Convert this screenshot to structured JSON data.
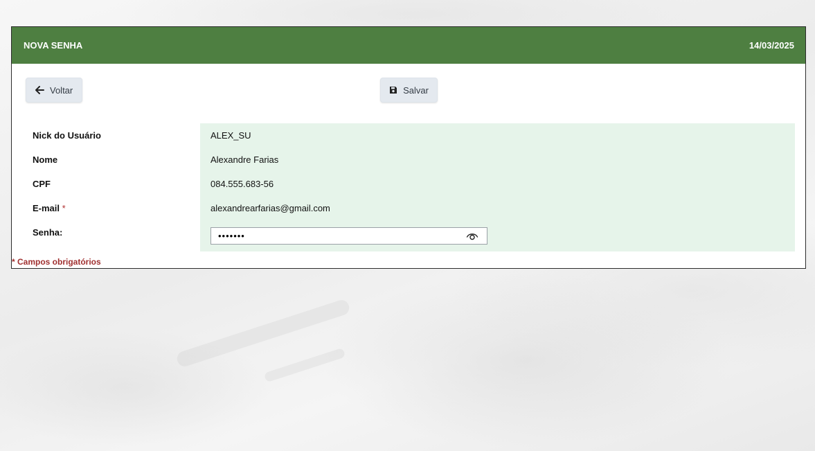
{
  "header": {
    "title": "NOVA SENHA",
    "date": "14/03/2025"
  },
  "toolbar": {
    "back_label": "Voltar",
    "save_label": "Salvar"
  },
  "form": {
    "fields": [
      {
        "label": "Nick do Usuário",
        "value": "ALEX_SU"
      },
      {
        "label": "Nome",
        "value": "Alexandre Farias"
      },
      {
        "label": "CPF",
        "value": "084.555.683-56"
      },
      {
        "label": "E-mail",
        "required_mark": "*",
        "value": "alexandrearfarias@gmail.com"
      }
    ],
    "password": {
      "label": "Senha:",
      "value": "•••••••"
    }
  },
  "footnote": "* Campos obrigatórios",
  "colors": {
    "header_bg": "#4e7f41",
    "values_bg": "#e6f4ea",
    "required": "#a03030"
  },
  "icons": {
    "back": "arrow-left-icon",
    "save": "floppy-disk-icon",
    "toggle_password": "eye-icon"
  }
}
